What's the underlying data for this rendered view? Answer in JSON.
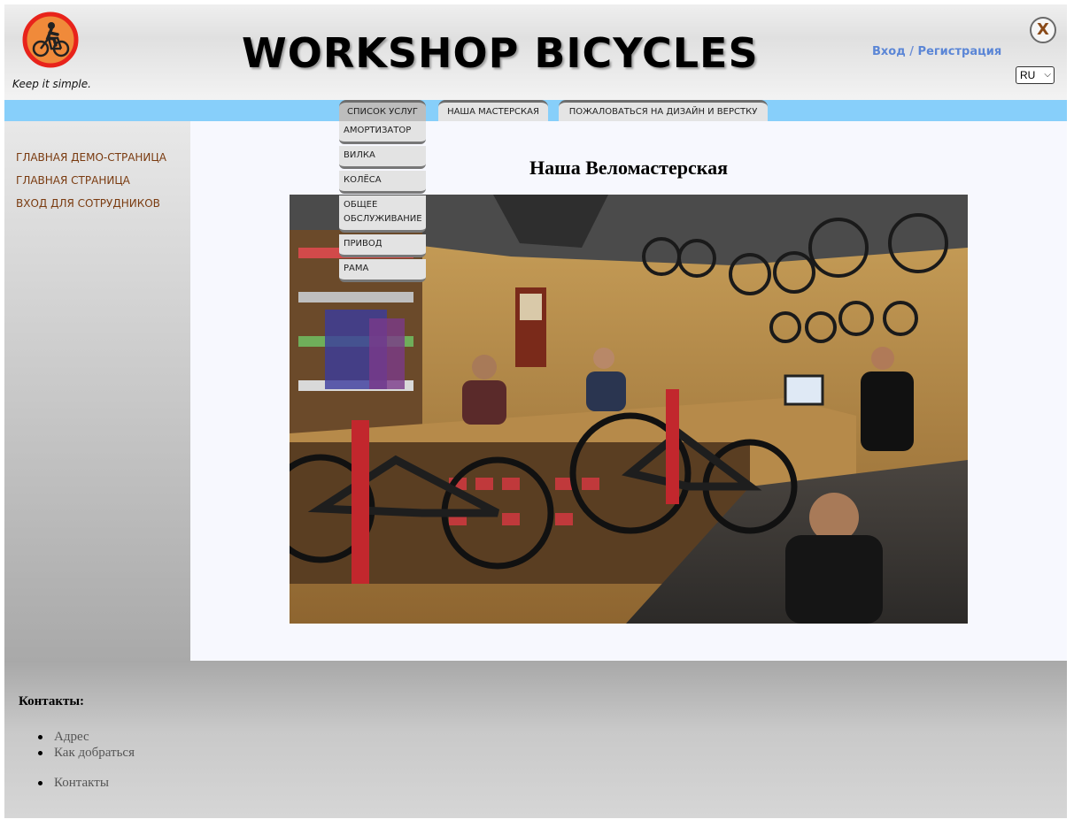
{
  "header": {
    "tagline": "Keep it simple.",
    "site_title": "WORKSHOP BICYCLES",
    "login_label": "Вход",
    "separator": "/",
    "register_label": "Регистрация",
    "close_label": "X",
    "language": "RU"
  },
  "nav": {
    "tabs": [
      {
        "label": "СПИСОК УСЛУГ",
        "active": true
      },
      {
        "label": "НАША МАСТЕРСКАЯ",
        "active": false
      },
      {
        "label": "ПОЖАЛОВАТЬСЯ НА ДИЗАЙН И ВЕРСТКУ",
        "active": false
      }
    ],
    "dropdown": [
      "АМОРТИЗАТОР",
      "ВИЛКА",
      "КОЛЁСА",
      "ОБЩЕЕ ОБСЛУЖИВАНИЕ",
      "ПРИВОД",
      "РАМА"
    ]
  },
  "sidebar": {
    "items": [
      {
        "label": "ГЛАВНАЯ ДЕМО-СТРАНИЦА"
      },
      {
        "label": "ГЛАВНАЯ СТРАНИЦА"
      },
      {
        "label": "ВХОД ДЛЯ СОТРУДНИКОВ"
      }
    ]
  },
  "main": {
    "title": "Наша Веломастерская"
  },
  "footer": {
    "title": "Контакты:",
    "group1": [
      "Адрес",
      "Как добраться"
    ],
    "group2": [
      "Контакты"
    ]
  },
  "colors": {
    "nav_bar": "#87cffa",
    "link_brown": "#7a3b10",
    "auth_blue": "#5b86d6",
    "logo_red": "#e8231b"
  }
}
